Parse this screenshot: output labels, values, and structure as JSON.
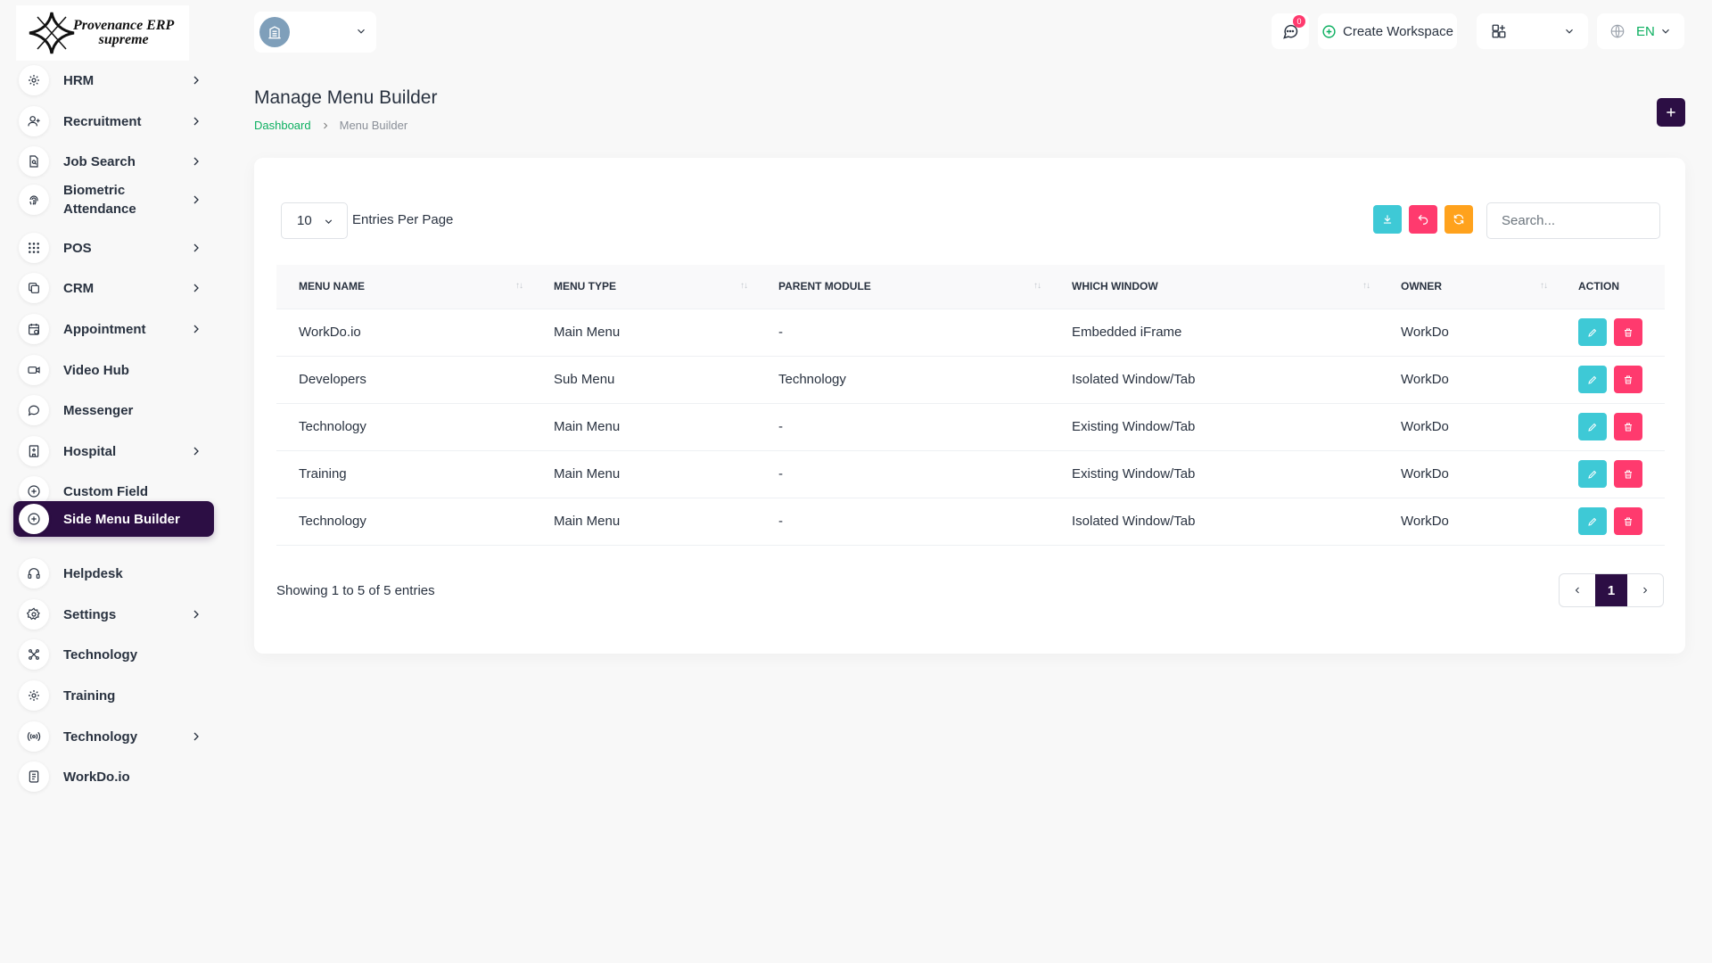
{
  "app": {
    "logo_line1": "Provenance ERP",
    "logo_line2": "supreme"
  },
  "colors": {
    "brand": "#2c0e44",
    "accent_green": "#0caf60",
    "info": "#3ec9d6",
    "danger": "#ff3a6e",
    "warning": "#ffa21d"
  },
  "sidebar": {
    "items": [
      {
        "label": "HRM",
        "icon": "hrm-icon",
        "has_children": true
      },
      {
        "label": "Recruitment",
        "icon": "user-plus-icon",
        "has_children": true
      },
      {
        "label": "Job Search",
        "icon": "file-search-icon",
        "has_children": true
      },
      {
        "label": "Biometric Attendance",
        "icon": "fingerprint-icon",
        "has_children": true
      },
      {
        "label": "POS",
        "icon": "grid-dots-icon",
        "has_children": true
      },
      {
        "label": "CRM",
        "icon": "layers-icon",
        "has_children": true
      },
      {
        "label": "Appointment",
        "icon": "calendar-icon",
        "has_children": true
      },
      {
        "label": "Video Hub",
        "icon": "video-icon",
        "has_children": false
      },
      {
        "label": "Messenger",
        "icon": "message-icon",
        "has_children": false
      },
      {
        "label": "Hospital",
        "icon": "hospital-icon",
        "has_children": true
      },
      {
        "label": "Custom Field",
        "icon": "plus-circle-icon",
        "has_children": false
      },
      {
        "label": "Side Menu Builder",
        "icon": "plus-circle-icon",
        "has_children": false,
        "active": true
      },
      {
        "label": "Helpdesk",
        "icon": "headset-icon",
        "has_children": false
      },
      {
        "label": "Settings",
        "icon": "gear-icon",
        "has_children": true
      },
      {
        "label": "Technology",
        "icon": "network-icon",
        "has_children": false
      },
      {
        "label": "Training",
        "icon": "hrm-icon",
        "has_children": false
      },
      {
        "label": "Technology",
        "icon": "broadcast-icon",
        "has_children": true
      },
      {
        "label": "WorkDo.io",
        "icon": "document-icon",
        "has_children": false
      }
    ]
  },
  "header": {
    "message_count": "0",
    "create_workspace_label": "Create Workspace",
    "language": "EN"
  },
  "page": {
    "title": "Manage Menu Builder",
    "breadcrumb": [
      "Dashboard",
      "Menu Builder"
    ]
  },
  "table_controls": {
    "per_page_value": "10",
    "per_page_label": "Entries Per Page",
    "search_placeholder": "Search..."
  },
  "table": {
    "columns": [
      "MENU NAME",
      "MENU TYPE",
      "PARENT MODULE",
      "WHICH WINDOW",
      "OWNER",
      "ACTION"
    ],
    "rows": [
      [
        "WorkDo.io",
        "Main Menu",
        "-",
        "Embedded iFrame",
        "WorkDo"
      ],
      [
        "Developers",
        "Sub Menu",
        "Technology",
        "Isolated Window/Tab",
        "WorkDo"
      ],
      [
        "Technology",
        "Main Menu",
        "-",
        "Existing Window/Tab",
        "WorkDo"
      ],
      [
        "Training",
        "Main Menu",
        "-",
        "Existing Window/Tab",
        "WorkDo"
      ],
      [
        "Technology",
        "Main Menu",
        "-",
        "Isolated Window/Tab",
        "WorkDo"
      ]
    ]
  },
  "pagination": {
    "summary": "Showing 1 to 5 of 5 entries",
    "current_page": "1"
  }
}
